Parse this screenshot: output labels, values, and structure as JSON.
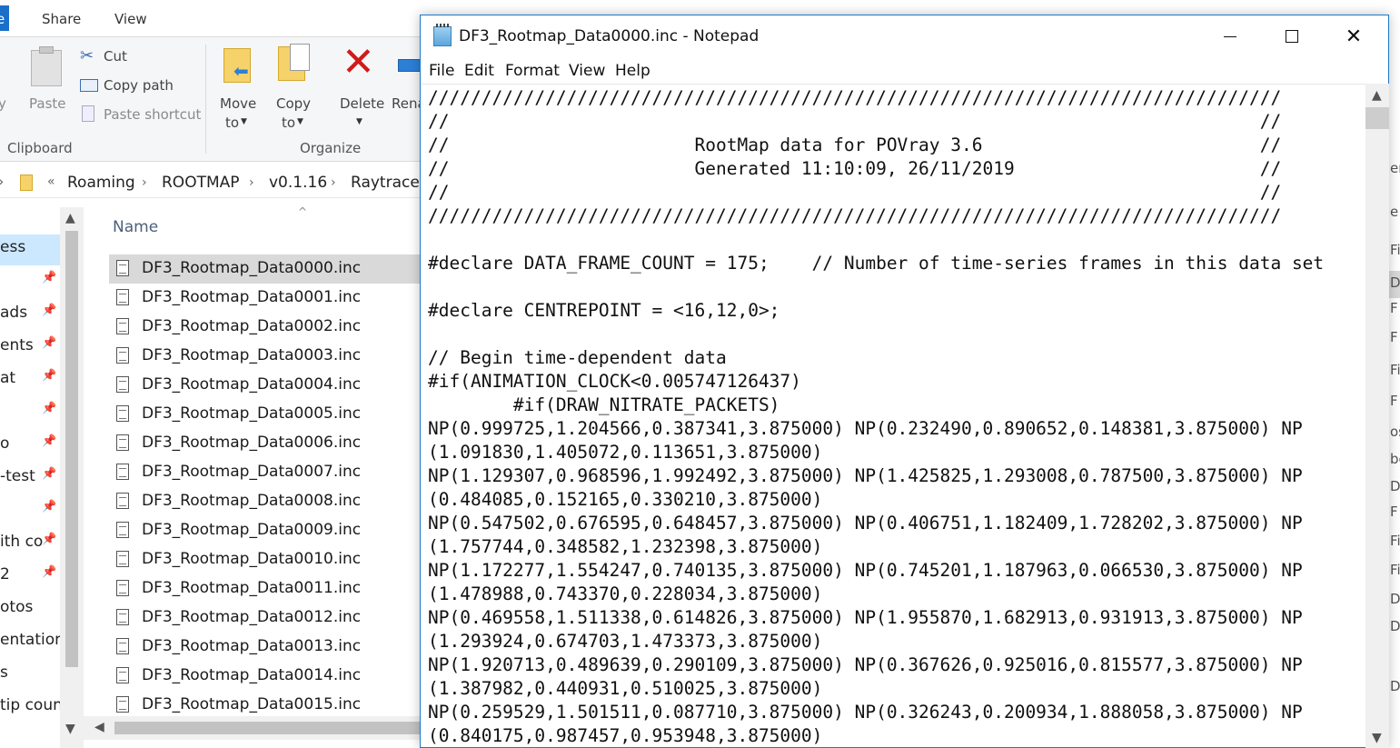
{
  "explorer": {
    "tabs": {
      "file_stub": "e",
      "share": "Share",
      "view": "View"
    },
    "ribbon": {
      "copy_stub": "y",
      "paste": "Paste",
      "cut": "Cut",
      "copy_path": "Copy path",
      "paste_shortcut": "Paste shortcut",
      "move_to": "Move",
      "move_to_2": "to",
      "copy_to": "Copy",
      "copy_to_2": "to",
      "delete": "Delete",
      "rename_stub": "Rena",
      "group_clipboard": "Clipboard",
      "group_organize": "Organize"
    },
    "address": {
      "overflow": "«",
      "crumbs": [
        "Roaming",
        "ROOTMAP",
        "v0.1.16",
        "Raytracer"
      ]
    },
    "nav_items": [
      "ess",
      "",
      "ads",
      "ents",
      "at",
      "",
      "o",
      "-test",
      "",
      "ith co",
      "2",
      "otos",
      "entation",
      "s",
      "tip count"
    ],
    "column_name": "Name",
    "files": [
      "DF3_Rootmap_Data0000.inc",
      "DF3_Rootmap_Data0001.inc",
      "DF3_Rootmap_Data0002.inc",
      "DF3_Rootmap_Data0003.inc",
      "DF3_Rootmap_Data0004.inc",
      "DF3_Rootmap_Data0005.inc",
      "DF3_Rootmap_Data0006.inc",
      "DF3_Rootmap_Data0007.inc",
      "DF3_Rootmap_Data0008.inc",
      "DF3_Rootmap_Data0009.inc",
      "DF3_Rootmap_Data0010.inc",
      "DF3_Rootmap_Data0011.inc",
      "DF3_Rootmap_Data0012.inc",
      "DF3_Rootmap_Data0013.inc",
      "DF3_Rootmap_Data0014.inc",
      "DF3_Rootmap_Data0015.inc"
    ],
    "right_strip": [
      "er",
      "e",
      "Fi",
      "D",
      "F",
      "F",
      "Fi",
      "F",
      "os",
      "be",
      "D",
      "F",
      "Fi",
      "Fi",
      "D",
      "D",
      "D"
    ]
  },
  "notepad": {
    "title": "DF3_Rootmap_Data0000.inc - Notepad",
    "menu": [
      "File",
      "Edit",
      "Format",
      "View",
      "Help"
    ],
    "lines": [
      "////////////////////////////////////////////////////////////////////////////////",
      "//                                                                            //",
      "//                       RootMap data for POVray 3.6                          //",
      "//                       Generated 11:10:09, 26/11/2019                       //",
      "//                                                                            //",
      "////////////////////////////////////////////////////////////////////////////////",
      "",
      "#declare DATA_FRAME_COUNT = 175;    // Number of time-series frames in this data set",
      "",
      "#declare CENTREPOINT = <16,12,0>;",
      "",
      "// Begin time-dependent data",
      "#if(ANIMATION_CLOCK<0.005747126437)",
      "        #if(DRAW_NITRATE_PACKETS)",
      "NP(0.999725,1.204566,0.387341,3.875000) NP(0.232490,0.890652,0.148381,3.875000) NP",
      "(1.091830,1.405072,0.113651,3.875000)",
      "NP(1.129307,0.968596,1.992492,3.875000) NP(1.425825,1.293008,0.787500,3.875000) NP",
      "(0.484085,0.152165,0.330210,3.875000)",
      "NP(0.547502,0.676595,0.648457,3.875000) NP(0.406751,1.182409,1.728202,3.875000) NP",
      "(1.757744,0.348582,1.232398,3.875000)",
      "NP(1.172277,1.554247,0.740135,3.875000) NP(0.745201,1.187963,0.066530,3.875000) NP",
      "(1.478988,0.743370,0.228034,3.875000)",
      "NP(0.469558,1.511338,0.614826,3.875000) NP(1.955870,1.682913,0.931913,3.875000) NP",
      "(1.293924,0.674703,1.473373,3.875000)",
      "NP(1.920713,0.489639,0.290109,3.875000) NP(0.367626,0.925016,0.815577,3.875000) NP",
      "(1.387982,0.440931,0.510025,3.875000)",
      "NP(0.259529,1.501511,0.087710,3.875000) NP(0.326243,0.200934,1.888058,3.875000) NP",
      "(0.840175,0.987457,0.953948,3.875000)"
    ]
  }
}
